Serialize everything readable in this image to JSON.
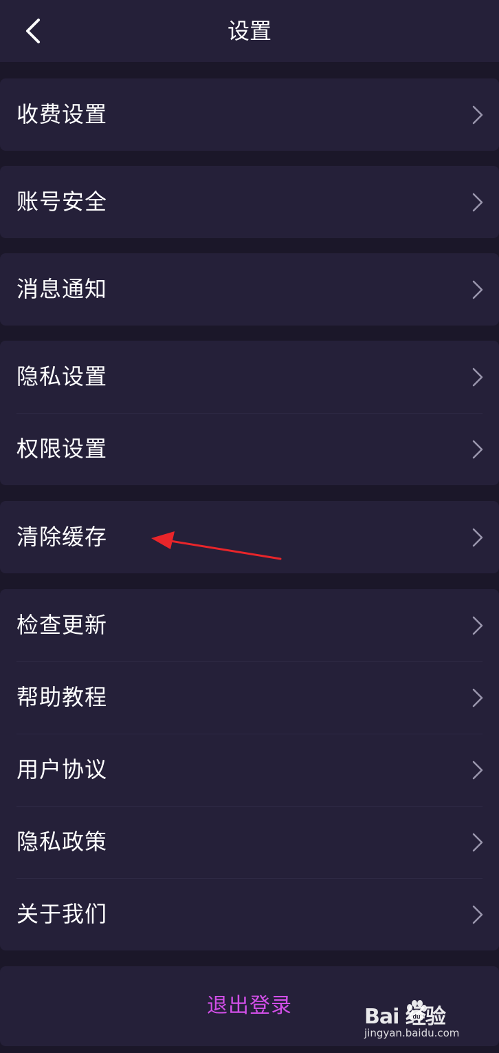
{
  "header": {
    "title": "设置",
    "back_icon": "chevron-left-icon"
  },
  "groups": [
    {
      "items": [
        {
          "label": "收费设置"
        }
      ]
    },
    {
      "items": [
        {
          "label": "账号安全"
        }
      ]
    },
    {
      "items": [
        {
          "label": "消息通知"
        }
      ]
    },
    {
      "items": [
        {
          "label": "隐私设置"
        },
        {
          "label": "权限设置"
        }
      ]
    },
    {
      "items": [
        {
          "label": "清除缓存"
        }
      ]
    },
    {
      "items": [
        {
          "label": "检查更新"
        },
        {
          "label": "帮助教程"
        },
        {
          "label": "用户协议"
        },
        {
          "label": "隐私政策"
        },
        {
          "label": "关于我们"
        }
      ]
    }
  ],
  "logout": {
    "label": "退出登录"
  },
  "watermark": {
    "brand": "Bai  经验",
    "url": "jingyan.baidu.com"
  },
  "colors": {
    "background": "#1b1729",
    "panel": "#252039",
    "logout_text": "#d24fe8",
    "annotation_arrow": "#e8252a"
  }
}
